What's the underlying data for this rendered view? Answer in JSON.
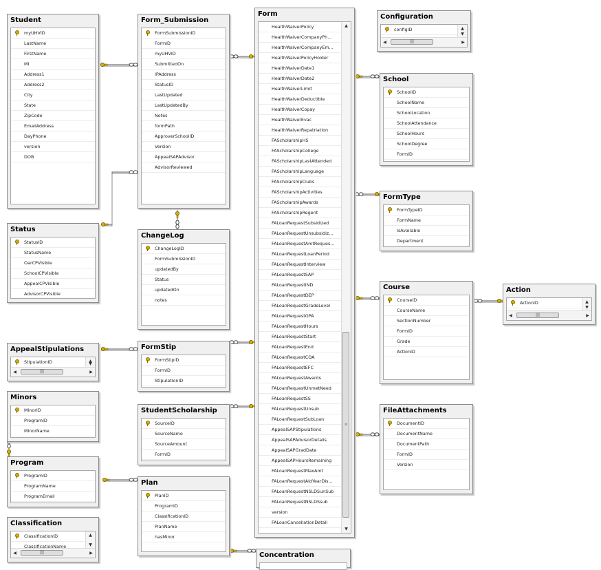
{
  "tables": {
    "student": {
      "title": "Student",
      "columns": [
        {
          "name": "myUHVID",
          "pk": true
        },
        {
          "name": "LastName"
        },
        {
          "name": "FirstName"
        },
        {
          "name": "MI"
        },
        {
          "name": "Address1"
        },
        {
          "name": "Address2"
        },
        {
          "name": "City"
        },
        {
          "name": "State"
        },
        {
          "name": "ZipCode"
        },
        {
          "name": "EmailAddress"
        },
        {
          "name": "DayPhone"
        },
        {
          "name": "version"
        },
        {
          "name": "DOB"
        }
      ]
    },
    "status": {
      "title": "Status",
      "columns": [
        {
          "name": "StatusID",
          "pk": true
        },
        {
          "name": "StatusName"
        },
        {
          "name": "OarCPVisible"
        },
        {
          "name": "SchoolCPVisible"
        },
        {
          "name": "AppealCPVisible"
        },
        {
          "name": "AdvisorCPVisible"
        }
      ]
    },
    "appeal_stipulations": {
      "title": "AppealStipulations",
      "columns": [
        {
          "name": "StipulationID",
          "pk": true
        }
      ]
    },
    "minors": {
      "title": "Minors",
      "columns": [
        {
          "name": "MinorID",
          "pk": true
        },
        {
          "name": "ProgramID"
        },
        {
          "name": "MinorName"
        }
      ]
    },
    "program": {
      "title": "Program",
      "columns": [
        {
          "name": "ProgramID",
          "pk": true
        },
        {
          "name": "ProgramName"
        },
        {
          "name": "ProgramEmail"
        }
      ]
    },
    "classification": {
      "title": "Classification",
      "columns": [
        {
          "name": "ClassificationID",
          "pk": true
        },
        {
          "name": "ClassificationName"
        }
      ]
    },
    "form_submission": {
      "title": "Form_Submission",
      "columns": [
        {
          "name": "FormSubmissionID",
          "pk": true
        },
        {
          "name": "FormID"
        },
        {
          "name": "myUHVID"
        },
        {
          "name": "SubmittedOn"
        },
        {
          "name": "IPAddress"
        },
        {
          "name": "StatusID"
        },
        {
          "name": "LastUpdated"
        },
        {
          "name": "LastUpdatedBy"
        },
        {
          "name": "Notes"
        },
        {
          "name": "formPath"
        },
        {
          "name": "ApproverSchoolID"
        },
        {
          "name": "Version"
        },
        {
          "name": "AppealSAPAdvisor"
        },
        {
          "name": "AdvisorReviewed"
        }
      ]
    },
    "change_log": {
      "title": "ChangeLog",
      "columns": [
        {
          "name": "ChangeLogID",
          "pk": true
        },
        {
          "name": "FormSubmissionID"
        },
        {
          "name": "updatedBy"
        },
        {
          "name": "Status"
        },
        {
          "name": "updatedOn"
        },
        {
          "name": "notes"
        }
      ]
    },
    "form_stip": {
      "title": "FormStip",
      "columns": [
        {
          "name": "FormStipID",
          "pk": true
        },
        {
          "name": "FormID"
        },
        {
          "name": "StipulationID"
        }
      ]
    },
    "student_scholarship": {
      "title": "StudentScholarship",
      "columns": [
        {
          "name": "SourceID",
          "pk": true
        },
        {
          "name": "SourceName"
        },
        {
          "name": "SourceAmount"
        },
        {
          "name": "FormID"
        }
      ]
    },
    "plan": {
      "title": "Plan",
      "columns": [
        {
          "name": "PlanID",
          "pk": true
        },
        {
          "name": "ProgramID"
        },
        {
          "name": "ClassificationID"
        },
        {
          "name": "PlanName"
        },
        {
          "name": "hasMinor"
        }
      ]
    },
    "form": {
      "title": "Form",
      "columns": [
        {
          "name": "HealthWaiverPolicy"
        },
        {
          "name": "HealthWaiverCompanyPh..."
        },
        {
          "name": "HealthWaiverCompanyEm..."
        },
        {
          "name": "HealthWaiverPolicyHolder"
        },
        {
          "name": "HealthWaiverDate1"
        },
        {
          "name": "HealthWaiverDate2"
        },
        {
          "name": "HealthWaiverLimit"
        },
        {
          "name": "HealthWaiverDeductible"
        },
        {
          "name": "HealthWaiverCopay"
        },
        {
          "name": "HealthWaiverEvac"
        },
        {
          "name": "HealthWaiverRepatriation"
        },
        {
          "name": "FAScholarshipHS"
        },
        {
          "name": "FAScholarshipCollege"
        },
        {
          "name": "FAScholarshipLastAttended"
        },
        {
          "name": "FAScholarshipLanguage"
        },
        {
          "name": "FAScholarshipClubs"
        },
        {
          "name": "FAScholarshipActivities"
        },
        {
          "name": "FAScholarshipAwards"
        },
        {
          "name": "FAScholarshipRegent"
        },
        {
          "name": "FALoanRequestSubsidized"
        },
        {
          "name": "FALoanRequestUnsubsidiz..."
        },
        {
          "name": "FALoanRequestAmtReques..."
        },
        {
          "name": "FALoanRequestLoanPeriod"
        },
        {
          "name": "FALoanRequestInterview"
        },
        {
          "name": "FALoanRequestSAP"
        },
        {
          "name": "FALoanRequestIND"
        },
        {
          "name": "FALoanRequestDEP"
        },
        {
          "name": "FALoanRequestGradeLevel"
        },
        {
          "name": "FALoanRequestGPA"
        },
        {
          "name": "FALoanRequestHours"
        },
        {
          "name": "FALoanRequestStart"
        },
        {
          "name": "FALoanRequestEnd"
        },
        {
          "name": "FALoanRequestCOA"
        },
        {
          "name": "FALoanRequestEFC"
        },
        {
          "name": "FALoanRequestAwards"
        },
        {
          "name": "FALoanRequestUnmetNeed"
        },
        {
          "name": "FALoanRequestSS"
        },
        {
          "name": "FALoanRequestUnsub"
        },
        {
          "name": "FALoanRequestSubLoan"
        },
        {
          "name": "AppealSAPStipulations"
        },
        {
          "name": "AppealSAPAdvisorDetails"
        },
        {
          "name": "AppealSAPGradDate"
        },
        {
          "name": "AppealSAPHoursRemaining"
        },
        {
          "name": "FALoanRequestMaxAmt"
        },
        {
          "name": "FALoanRequestAidYearDis..."
        },
        {
          "name": "FALoanRequestNSLDSunSub"
        },
        {
          "name": "FALoanRequestNSLDSsub"
        },
        {
          "name": "version"
        },
        {
          "name": "FALoanCancellationDetail"
        }
      ]
    },
    "concentration": {
      "title": "Concentration",
      "columns": []
    },
    "configuration": {
      "title": "Configuration",
      "columns": [
        {
          "name": "configID",
          "pk": true
        }
      ]
    },
    "school": {
      "title": "School",
      "columns": [
        {
          "name": "SchoolID",
          "pk": true
        },
        {
          "name": "SchoolName"
        },
        {
          "name": "SchoolLocation"
        },
        {
          "name": "SchoolAttendance"
        },
        {
          "name": "SchoolHours"
        },
        {
          "name": "SchoolDegree"
        },
        {
          "name": "FormID"
        }
      ]
    },
    "form_type": {
      "title": "FormType",
      "columns": [
        {
          "name": "FormTypeID",
          "pk": true
        },
        {
          "name": "FormName"
        },
        {
          "name": "IsAvailable"
        },
        {
          "name": "Department"
        }
      ]
    },
    "course": {
      "title": "Course",
      "columns": [
        {
          "name": "CourseID",
          "pk": true
        },
        {
          "name": "CourseName"
        },
        {
          "name": "SectionNumber"
        },
        {
          "name": "FormID"
        },
        {
          "name": "Grade"
        },
        {
          "name": "ActionID"
        }
      ]
    },
    "action": {
      "title": "Action",
      "columns": [
        {
          "name": "ActionID",
          "pk": true
        }
      ]
    },
    "file_attachments": {
      "title": "FileAttachments",
      "columns": [
        {
          "name": "DocumentID",
          "pk": true
        },
        {
          "name": "DocumentName"
        },
        {
          "name": "DocumentPath"
        },
        {
          "name": "FormID"
        },
        {
          "name": "Version"
        }
      ]
    }
  },
  "icons": {
    "primary_key": "key-icon",
    "relationship_one": "key-end-icon",
    "relationship_many": "infinity-end-icon"
  },
  "colors": {
    "key": "#d8b000",
    "line": "#555555",
    "header_bg": "#f0f0f0",
    "border": "#8a8a8a"
  }
}
